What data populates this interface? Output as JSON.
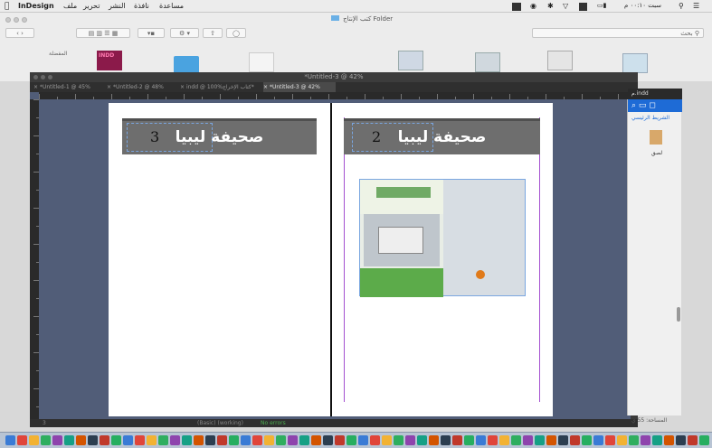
{
  "menubar": {
    "app_name": "InDesign",
    "items": [
      "ملف",
      "تحرير",
      "النشر",
      "نافذة",
      "مساعدة"
    ],
    "right_text": "سبت ٠٠:١٠ م"
  },
  "finder": {
    "title": "كتب الإنتاج Folder",
    "search_placeholder": "بحث",
    "sidebar_label": "المفضلة",
    "indd_label": "INDD"
  },
  "indesign": {
    "window_title": "*Untitled-3 @ 42%",
    "tabs": [
      {
        "label": "*Untitled-1 @ 45%",
        "active": false
      },
      {
        "label": "*Untitled-2 @ 48%",
        "active": false
      },
      {
        "label": "indd @ 100%كتاب الإخراج*",
        "active": false
      },
      {
        "label": "*Untitled-3 @ 42%",
        "active": true
      }
    ],
    "ruler_marks": [
      "",
      "",
      "",
      "",
      "",
      "",
      "",
      "",
      ""
    ],
    "left_page": {
      "number": "3",
      "banner_title": "صحيفة ليبيا"
    },
    "right_page": {
      "number": "2",
      "banner_title": "صحيفة ليبيا"
    },
    "status": {
      "page": "3",
      "profile": "(Basic) (working)",
      "errors": "No errors"
    }
  },
  "panel": {
    "title": "الشريط الرئيسي",
    "file_label": "م.indd",
    "label": "لصق",
    "footer": "المساحة: 55 ي"
  },
  "colors": {
    "pasteboard": "#515d78",
    "banner": "#6e6e6e",
    "guide_purple": "#a450d0",
    "dark_chrome": "#2f2f2f"
  }
}
